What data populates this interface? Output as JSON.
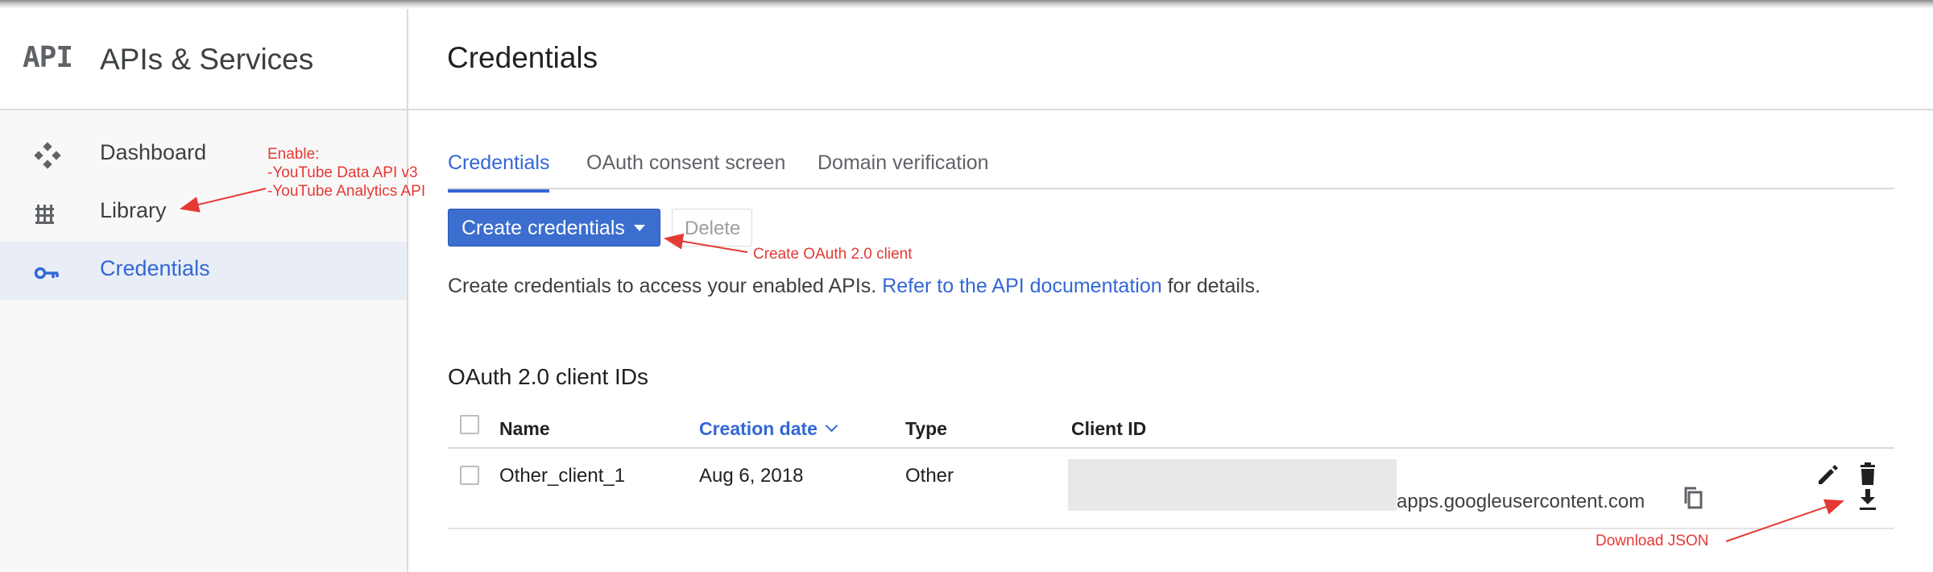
{
  "sidebar": {
    "logo": "API",
    "title": "APIs & Services",
    "items": [
      {
        "label": "Dashboard",
        "icon": "dashboard-icon"
      },
      {
        "label": "Library",
        "icon": "library-icon"
      },
      {
        "label": "Credentials",
        "icon": "key-icon",
        "active": true
      }
    ]
  },
  "header": {
    "title": "Credentials"
  },
  "tabs": [
    {
      "label": "Credentials",
      "active": true
    },
    {
      "label": "OAuth consent screen"
    },
    {
      "label": "Domain verification"
    }
  ],
  "toolbar": {
    "create_label": "Create credentials",
    "delete_label": "Delete"
  },
  "description": {
    "prefix": "Create credentials to access your enabled APIs.",
    "link": "Refer to the API documentation",
    "suffix": "for details."
  },
  "section": {
    "title": "OAuth 2.0 client IDs"
  },
  "table": {
    "columns": [
      "Name",
      "Creation date",
      "Type",
      "Client ID"
    ],
    "sorted_column": "Creation date",
    "rows": [
      {
        "name": "Other_client_1",
        "date": "Aug 6, 2018",
        "type": "Other",
        "client_id_suffix": "apps.googleusercontent.com"
      }
    ]
  },
  "annotations": {
    "enable": [
      "Enable:",
      "-YouTube Data API v3",
      "-YouTube Analytics API"
    ],
    "create_oauth": "Create OAuth 2.0 client",
    "download": "Download JSON"
  },
  "colors": {
    "accent": "#3367d6",
    "annotation": "#e53935",
    "primary_button": "#3b6ecf"
  }
}
